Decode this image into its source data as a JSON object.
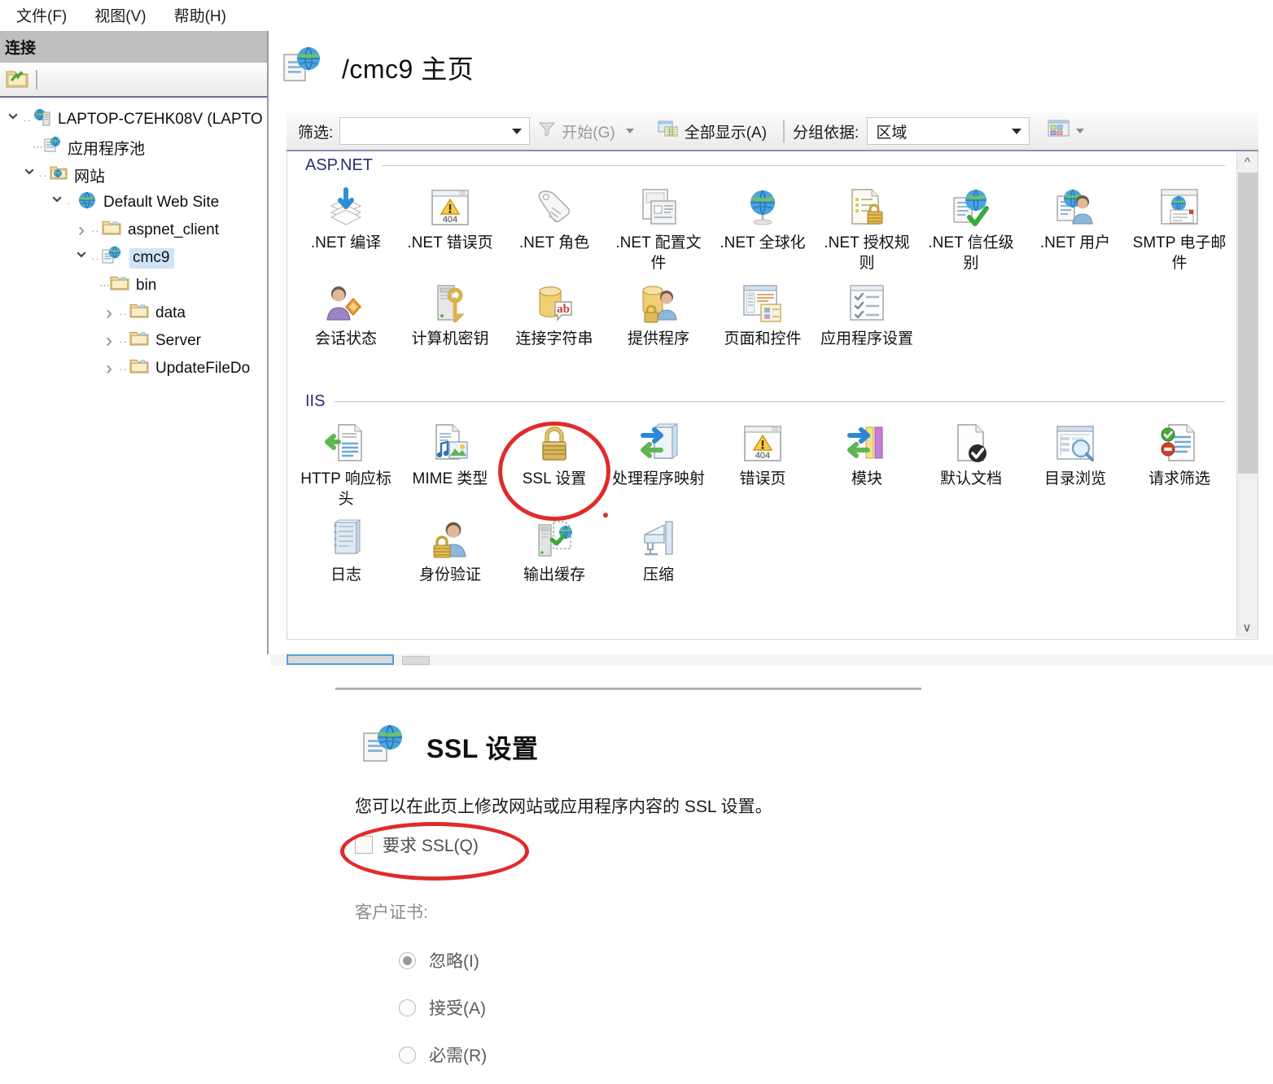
{
  "menu": {
    "items": [
      {
        "label": "文件(F)",
        "name": "menu-file"
      },
      {
        "label": "视图(V)",
        "name": "menu-view"
      },
      {
        "label": "帮助(H)",
        "name": "menu-help"
      }
    ]
  },
  "connections": {
    "title": "连接",
    "toolbar": {
      "connect_icon": "connect-to-folder-icon"
    },
    "tree": [
      {
        "label": "LAPTOP-C7EHK08V (LAPTO",
        "icon": "server-icon",
        "indent": 0,
        "twisty": "expanded",
        "selected": false
      },
      {
        "label": "应用程序池",
        "icon": "app-pools-icon",
        "indent": 1,
        "twisty": "none",
        "selected": false
      },
      {
        "label": "网站",
        "icon": "sites-folder-icon",
        "indent": 1,
        "twisty": "expanded",
        "selected": false
      },
      {
        "label": "Default Web Site",
        "icon": "website-globe-icon",
        "indent": 2,
        "twisty": "expanded",
        "selected": false
      },
      {
        "label": "aspnet_client",
        "icon": "folder-icon",
        "indent": 3,
        "twisty": "collapsed",
        "selected": false
      },
      {
        "label": "cmc9",
        "icon": "application-icon",
        "indent": 3,
        "twisty": "expanded",
        "selected": true
      },
      {
        "label": "bin",
        "icon": "folder-icon",
        "indent": 4,
        "twisty": "none",
        "selected": false
      },
      {
        "label": "data",
        "icon": "folder-icon",
        "indent": 4,
        "twisty": "collapsed",
        "selected": false
      },
      {
        "label": "Server",
        "icon": "folder-icon",
        "indent": 4,
        "twisty": "collapsed",
        "selected": false
      },
      {
        "label": "UpdateFileDo",
        "icon": "folder-icon",
        "indent": 4,
        "twisty": "collapsed",
        "selected": false
      }
    ]
  },
  "feature_view": {
    "title": "/cmc9 主页",
    "title_icon": "application-icon",
    "filter_bar": {
      "filter_label": "筛选:",
      "filter_value": "",
      "go_label": "开始(G)",
      "go_icon": "funnel-icon",
      "show_all_label": "全部显示(A)",
      "show_all_icon": "show-all-icon",
      "group_by_label": "分组依据:",
      "group_by_value": "区域",
      "view_mode_icon": "view-mode-icon"
    },
    "groups": [
      {
        "name": "ASP.NET",
        "collapse_icon": "chevron-up-icon",
        "items": [
          {
            "label": ".NET 编译",
            "icon": "net-compilation-icon"
          },
          {
            "label": ".NET 错误页",
            "icon": "net-error-pages-icon"
          },
          {
            "label": ".NET 角色",
            "icon": "net-roles-icon"
          },
          {
            "label": ".NET 配置文件",
            "icon": "net-profile-icon"
          },
          {
            "label": ".NET 全球化",
            "icon": "net-globalization-icon"
          },
          {
            "label": ".NET 授权规则",
            "icon": "net-authorization-rules-icon"
          },
          {
            "label": ".NET 信任级别",
            "icon": "net-trust-levels-icon"
          },
          {
            "label": ".NET 用户",
            "icon": "net-users-icon"
          },
          {
            "label": "SMTP 电子邮件",
            "icon": "smtp-email-icon"
          },
          {
            "label": "会话状态",
            "icon": "session-state-icon"
          },
          {
            "label": "计算机密钥",
            "icon": "machine-key-icon"
          },
          {
            "label": "连接字符串",
            "icon": "connection-strings-icon"
          },
          {
            "label": "提供程序",
            "icon": "providers-icon"
          },
          {
            "label": "页面和控件",
            "icon": "pages-and-controls-icon"
          },
          {
            "label": "应用程序设置",
            "icon": "application-settings-icon"
          }
        ]
      },
      {
        "name": "IIS",
        "collapse_icon": "chevron-up-icon",
        "items": [
          {
            "label": "HTTP 响应标头",
            "icon": "http-response-headers-icon"
          },
          {
            "label": "MIME 类型",
            "icon": "mime-types-icon"
          },
          {
            "label": "SSL 设置",
            "icon": "ssl-settings-padlock-icon",
            "highlighted": true
          },
          {
            "label": "处理程序映射",
            "icon": "handler-mappings-icon"
          },
          {
            "label": "错误页",
            "icon": "error-pages-icon"
          },
          {
            "label": "模块",
            "icon": "modules-icon"
          },
          {
            "label": "默认文档",
            "icon": "default-document-icon"
          },
          {
            "label": "目录浏览",
            "icon": "directory-browsing-icon"
          },
          {
            "label": "请求筛选",
            "icon": "request-filtering-icon"
          },
          {
            "label": "日志",
            "icon": "logging-icon"
          },
          {
            "label": "身份验证",
            "icon": "authentication-icon"
          },
          {
            "label": "输出缓存",
            "icon": "output-caching-icon"
          },
          {
            "label": "压缩",
            "icon": "compression-icon"
          }
        ]
      }
    ],
    "scrollbar": {
      "up_icon": "scroll-up-icon",
      "down_icon": "scroll-down-icon"
    }
  },
  "ssl_settings": {
    "title": "SSL 设置",
    "title_icon": "application-icon",
    "description": "您可以在此页上修改网站或应用程序内容的 SSL 设置。",
    "require_ssl_label": "要求 SSL(Q)",
    "require_ssl_checked": false,
    "client_cert_label": "客户证书:",
    "client_cert_options": [
      {
        "label": "忽略(I)",
        "selected": true
      },
      {
        "label": "接受(A)",
        "selected": false
      },
      {
        "label": "必需(R)",
        "selected": false
      }
    ]
  },
  "annotations": {
    "accent_color": "#e02b2b",
    "marks": [
      "ssl-settings-icon-circle",
      "require-ssl-checkbox-circle"
    ]
  }
}
